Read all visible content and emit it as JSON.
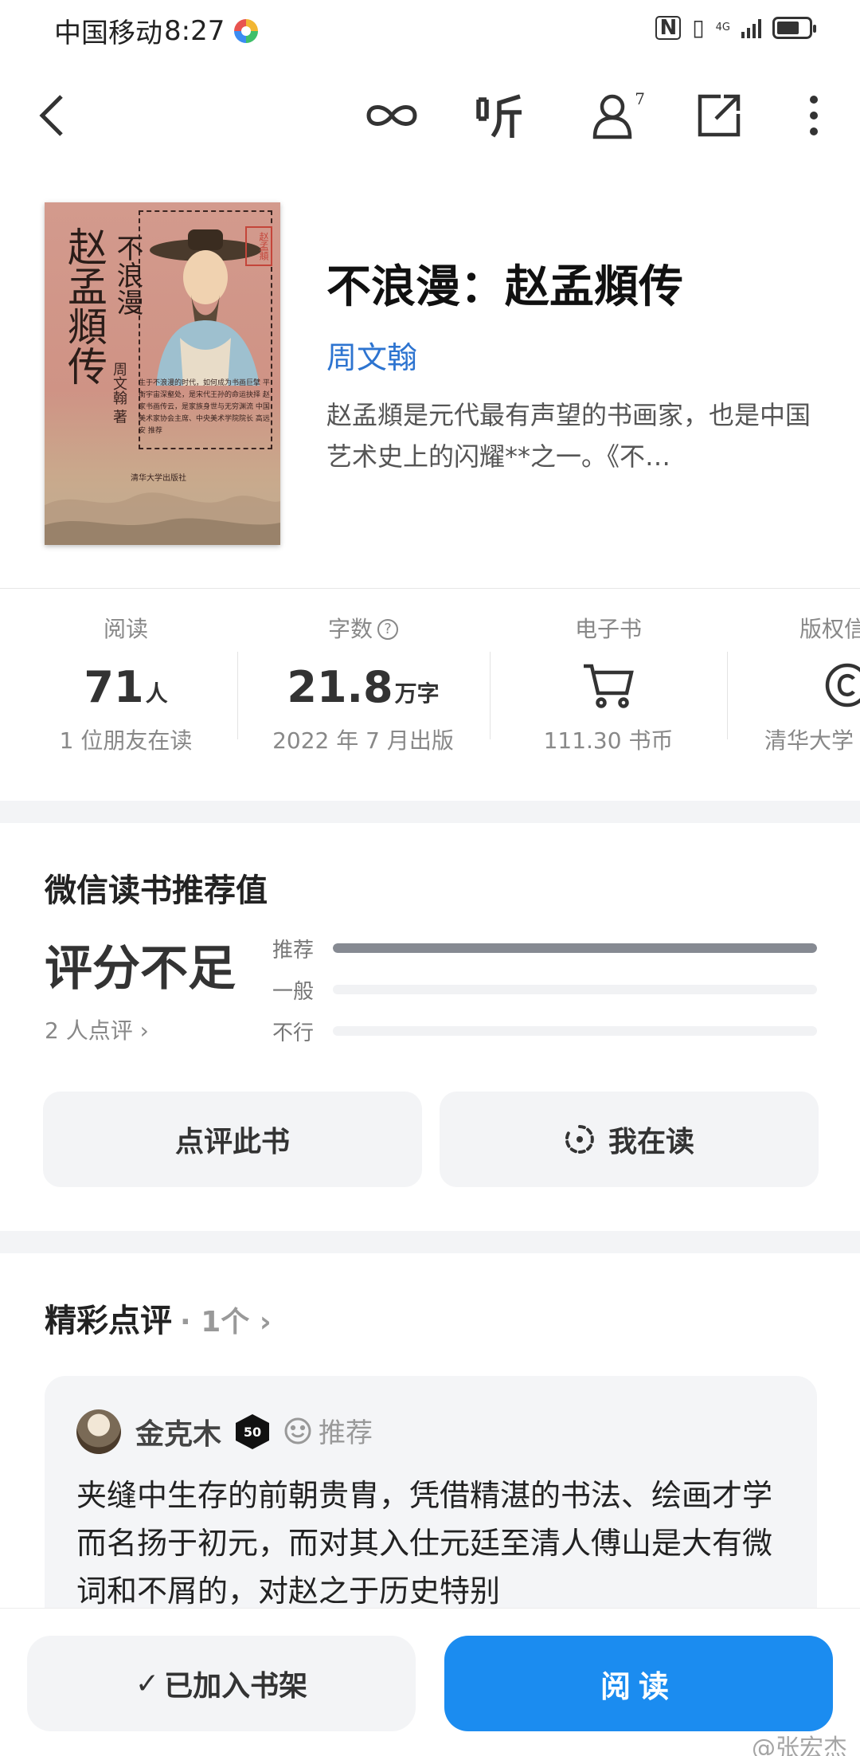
{
  "status_bar": {
    "carrier": "中国移动",
    "time": "8:27",
    "network": "4G"
  },
  "nav": {
    "icons": [
      "back-icon",
      "infinity-icon",
      "listen-icon",
      "readers-icon",
      "share-icon",
      "more-icon"
    ],
    "listen_label": "听",
    "readers_count": "7"
  },
  "book": {
    "title": "不浪漫：赵孟頫传",
    "author": "周文翰",
    "intro": "赵孟頫是元代最有声望的书画家，也是中国艺术史上的闪耀**之一。《不…",
    "cover": {
      "title_main": "赵孟頫传",
      "title_small": "不浪漫",
      "author": "周文翰 著",
      "seal": "赵孟頫",
      "blurb": "生于不浪漫的时代，如何成为书画巨擘 平衡宇宙深壑处，是宋代王孙的命运抉择 赵家书画传云，是家族身世与无穷渊流 中国美术家协会主席、中央美术学院院长 高远安 推荐",
      "publisher": "清华大学出版社"
    }
  },
  "stats": [
    {
      "label": "阅读",
      "value": "71",
      "unit": "人",
      "sub": "1 位朋友在读"
    },
    {
      "label": "字数",
      "value": "21.8",
      "unit": "万字",
      "sub": "2022 年 7 月出版"
    },
    {
      "label": "电子书",
      "icon": "cart-icon",
      "sub": "111.30 书币"
    },
    {
      "label": "版权信",
      "icon": "copyright-icon",
      "sub": "清华大学"
    }
  ],
  "recommendation": {
    "title": "微信读书推荐值",
    "score_text": "评分不足",
    "review_count": "2 人点评",
    "bars": [
      {
        "label": "推荐",
        "fraction": 1.0
      },
      {
        "label": "一般",
        "fraction": 0.0
      },
      {
        "label": "不行",
        "fraction": 0.0
      }
    ],
    "review_button": "点评此书",
    "reading_button": "我在读"
  },
  "reviews": {
    "heading": "精彩点评",
    "count": "1个",
    "items": [
      {
        "user": "金克木",
        "level": "50",
        "tag": "推荐",
        "text": "夹缝中生存的前朝贵胄，凭借精湛的书法、绘画才学而名扬于初元，而对其入仕元廷至清人傅山是大有微词和不屑的，对赵之于历史特别"
      }
    ]
  },
  "bottom_bar": {
    "shelf_button": "已加入书架",
    "read_button": "阅读"
  },
  "watermark": "@张宏杰",
  "colors": {
    "accent": "#1b8cf0",
    "author_link": "#2d74d0",
    "bar_fill": "#868a92"
  }
}
